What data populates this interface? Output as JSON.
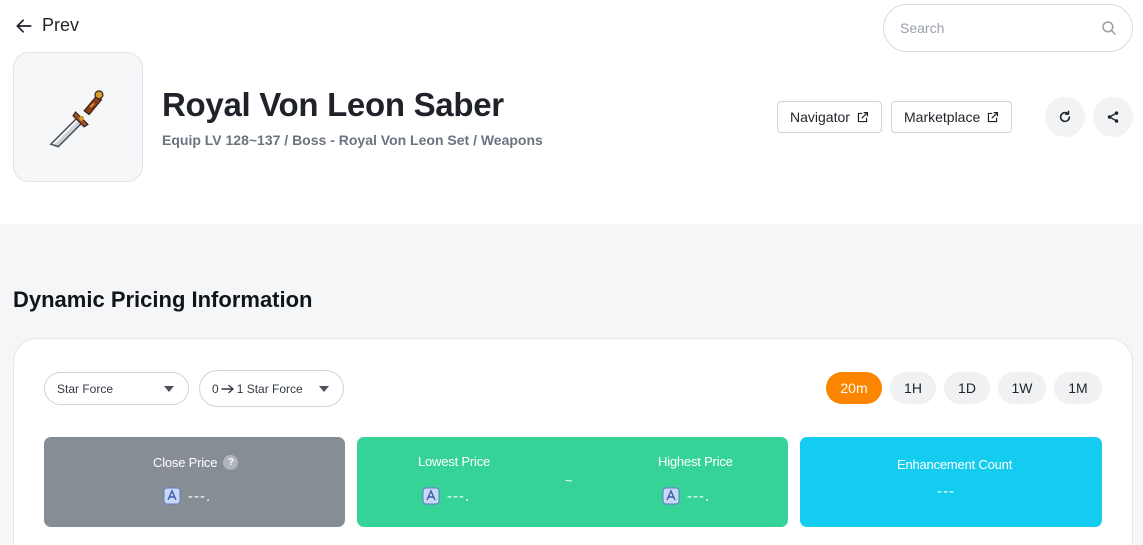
{
  "nav": {
    "prev_label": "Prev"
  },
  "search": {
    "placeholder": "Search"
  },
  "item": {
    "title": "Royal Von Leon Saber",
    "subtitle": "Equip LV 128~137 / Boss - Royal Von Leon Set / Weapons",
    "icon": "saber-item-icon"
  },
  "actions": {
    "navigator_label": "Navigator",
    "marketplace_label": "Marketplace",
    "refresh_icon": "refresh-icon",
    "share_icon": "share-icon"
  },
  "pricing": {
    "section_title": "Dynamic Pricing Information",
    "filter_type": "Star Force",
    "filter_from": "0",
    "filter_to": "1 Star Force",
    "periods": [
      "20m",
      "1H",
      "1D",
      "1W",
      "1M"
    ],
    "active_period": "20m",
    "close_price": {
      "label": "Close Price",
      "help": "?",
      "value": "---."
    },
    "lowest_price": {
      "label": "Lowest Price",
      "value": "---."
    },
    "range_separator": "~",
    "highest_price": {
      "label": "Highest Price",
      "value": "---."
    },
    "enhancement_count": {
      "label": "Enhancement Count",
      "value": "---"
    }
  },
  "colors": {
    "accent": "#fb8500",
    "close_card": "#878d94",
    "range_card": "#36d399",
    "enhancement_card": "#14cbf0",
    "page_bg_lower": "#f5f6f8"
  }
}
